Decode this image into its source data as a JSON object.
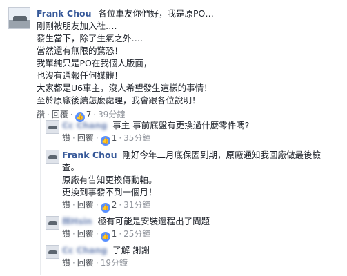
{
  "main": {
    "author": "Frank Chou",
    "lines": [
      "各位車友你們好，我是原PO…",
      "剛剛被朋友加入社….",
      "發生當下，除了生氣之外….",
      "當然還有無限的驚恐！",
      "我單純只是PO在我個人版面，",
      "也沒有通報任何媒體！",
      "大家都是U6車主，沒人希望發生這樣的事情！",
      "至於原廠後續怎麼處理，我會跟各位說明！"
    ],
    "like": "讚",
    "reply": "回覆",
    "likes": "7",
    "time": "39分鐘"
  },
  "replies": [
    {
      "author": "Cc Chang",
      "text": "事主 事前底盤有更換過什麼零件嗎?",
      "like": "讚",
      "reply": "回覆",
      "likes": "1",
      "time": "35分鐘"
    },
    {
      "author": "Frank Chou",
      "lines": [
        "剛好今年二月底保固到期，原廠通知我回廠做最後檢",
        "查。",
        "原廠有告知更換傳動軸。",
        "更換到事發不到一個月！"
      ],
      "like": "讚",
      "reply": "回覆",
      "likes": "2",
      "time": "31分鐘"
    },
    {
      "author": "林Hsin",
      "text": "極有可能是安裝過程出了問題",
      "like": "讚",
      "reply": "回覆",
      "likes": "1",
      "time": "25分鐘"
    },
    {
      "author": "Cc Chang",
      "text": "了解 謝謝",
      "like": "讚",
      "reply": "回覆",
      "time": "19分鐘"
    }
  ],
  "colors": {
    "name": "#365899",
    "like_badge": "#5890ff",
    "meta": "#90949c",
    "thread_line": "#e9ebee"
  }
}
